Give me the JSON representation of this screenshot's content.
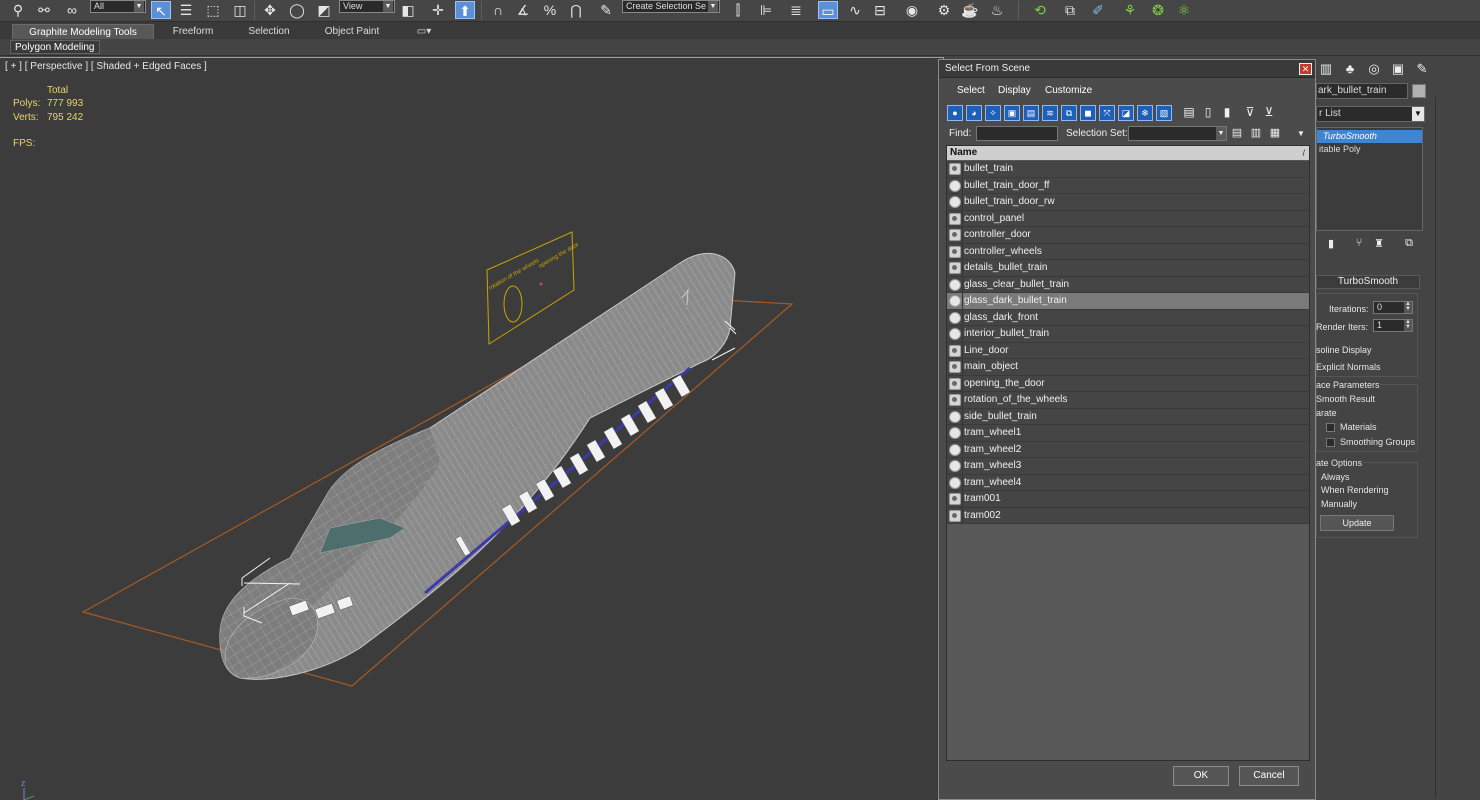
{
  "toolbar": {
    "selection_filter": "All",
    "ref_coord": "View",
    "named_selection": "Create Selection Se"
  },
  "ribbon": {
    "tabs": [
      "Graphite Modeling Tools",
      "Freeform",
      "Selection",
      "Object Paint"
    ],
    "active_tab": 0,
    "panel_button": "Polygon Modeling"
  },
  "viewport": {
    "label": "[ + ] [ Perspective ] [ Shaded + Edged Faces ]",
    "stats_total_label": "Total",
    "polys_label": "Polys:",
    "polys_value": "777 993",
    "verts_label": "Verts:",
    "verts_value": "795 242",
    "fps_label": "FPS:",
    "axis_label": "z"
  },
  "dialog": {
    "title": "Select From Scene",
    "close": "x",
    "menu": [
      "Select",
      "Display",
      "Customize"
    ],
    "find_label": "Find:",
    "find_value": "",
    "selection_set_label": "Selection Set:",
    "column_header": "Name",
    "sort_indicator": "/",
    "objects": [
      {
        "name": "bullet_train",
        "icon": "group-object-icon"
      },
      {
        "name": "bullet_train_door_ff",
        "icon": "geometry-sphere-icon"
      },
      {
        "name": "bullet_train_door_rw",
        "icon": "geometry-sphere-icon"
      },
      {
        "name": "control_panel",
        "icon": "group-object-icon"
      },
      {
        "name": "controller_door",
        "icon": "group-object-icon"
      },
      {
        "name": "controller_wheels",
        "icon": "group-object-icon"
      },
      {
        "name": "details_bullet_train",
        "icon": "group-object-icon"
      },
      {
        "name": "glass_clear_bullet_train",
        "icon": "geometry-sphere-icon"
      },
      {
        "name": "glass_dark_bullet_train",
        "icon": "geometry-sphere-icon",
        "selected": true
      },
      {
        "name": "glass_dark_front",
        "icon": "geometry-sphere-icon"
      },
      {
        "name": "interior_bullet_train",
        "icon": "geometry-sphere-icon"
      },
      {
        "name": "Line_door",
        "icon": "group-object-icon"
      },
      {
        "name": "main_object",
        "icon": "group-object-icon"
      },
      {
        "name": "opening_the_door",
        "icon": "group-object-icon"
      },
      {
        "name": "rotation_of_the_wheels",
        "icon": "group-object-icon"
      },
      {
        "name": "side_bullet_train",
        "icon": "geometry-sphere-icon"
      },
      {
        "name": "tram_wheel1",
        "icon": "geometry-sphere-icon"
      },
      {
        "name": "tram_wheel2",
        "icon": "geometry-sphere-icon"
      },
      {
        "name": "tram_wheel3",
        "icon": "geometry-sphere-icon"
      },
      {
        "name": "tram_wheel4",
        "icon": "geometry-sphere-icon"
      },
      {
        "name": "tram001",
        "icon": "group-object-icon"
      },
      {
        "name": "tram002",
        "icon": "group-object-icon"
      }
    ],
    "ok_label": "OK",
    "cancel_label": "Cancel"
  },
  "command_panel": {
    "object_name": "ark_bullet_train",
    "modifier_list": "r List",
    "stack": [
      "TurboSmooth",
      "itable Poly"
    ],
    "rollout_title": "TurboSmooth",
    "iterations_label": "Iterations:",
    "iterations_value": "0",
    "render_iters_label": "Render Iters:",
    "render_iters_value": "1",
    "isoline_display": "soline Display",
    "explicit_normals": "Explicit Normals",
    "surface_params": "ace Parameters",
    "smooth_result": "Smooth Result",
    "separate": "arate",
    "materials": "Materials",
    "smoothing_groups": "Smoothing Groups",
    "update_options": "ate Options",
    "always": "Always",
    "when_rendering": "When Rendering",
    "manually": "Manually",
    "update_button": "Update"
  },
  "colors": {
    "viewport_bg": "#3c3c3c",
    "selection_highlight": "#3e85d4",
    "stat_text": "#e8d36a",
    "active_border": "#c9a500"
  }
}
